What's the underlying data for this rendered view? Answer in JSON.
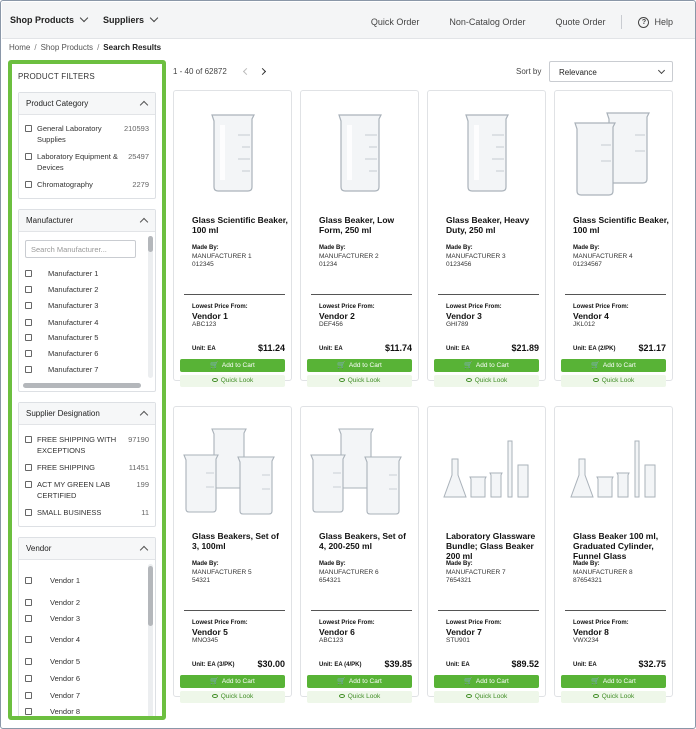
{
  "nav": {
    "shop_products": "Shop Products",
    "suppliers": "Suppliers",
    "quick_order": "Quick Order",
    "non_catalog_order": "Non-Catalog Order",
    "quote_order": "Quote Order",
    "help": "Help"
  },
  "breadcrumb": {
    "home": "Home",
    "shop": "Shop Products",
    "current": "Search Results"
  },
  "filters": {
    "title": "PRODUCT FILTERS",
    "category": {
      "title": "Product Category",
      "options": [
        {
          "label": "General Laboratory Supplies",
          "count": "210593"
        },
        {
          "label": "Laboratory Equipment & Devices",
          "count": "25497"
        },
        {
          "label": "Chromatography",
          "count": "2279"
        }
      ]
    },
    "manufacturer": {
      "title": "Manufacturer",
      "placeholder": "Search Manufacturer...",
      "options": [
        "Manufacturer 1",
        "Manufacturer 2",
        "Manufacturer 3",
        "Manufacturer 4",
        "Manufacturer 5",
        "Manufacturer 6",
        "Manufacturer 7"
      ]
    },
    "supplier": {
      "title": "Supplier Designation",
      "options": [
        {
          "label": "FREE SHIPPING WITH EXCEPTIONS",
          "count": "97190"
        },
        {
          "label": "FREE SHIPPING",
          "count": "11451"
        },
        {
          "label": "ACT MY GREEN LAB CERTIFIED",
          "count": "199"
        },
        {
          "label": "SMALL BUSINESS",
          "count": "11"
        }
      ]
    },
    "vendor": {
      "title": "Vendor",
      "options": [
        "Vendor 1",
        "Vendor 2",
        "Vendor 3",
        "Vendor 4",
        "Vendor 5",
        "Vendor 6",
        "Vendor 7",
        "Vendor 8"
      ]
    }
  },
  "results": {
    "count": "1 - 40 of 62872",
    "sort_label": "Sort by",
    "sort_value": "Relevance"
  },
  "labels": {
    "made_by": "Made By:",
    "lowest_price": "Lowest Price From:",
    "add_to_cart": "Add to Cart",
    "quick_look": "Quick Look"
  },
  "products": [
    {
      "name": "Glass Scientific Beaker, 100 ml",
      "mfr": "MANUFACTURER 1",
      "sku": "012345",
      "vendor": "Vendor 1",
      "vcode": "ABC123",
      "unit": "Unit: EA",
      "price": "$11.24",
      "image": "beaker-icon"
    },
    {
      "name": "Glass Beaker, Low Form, 250 ml",
      "mfr": "MANUFACTURER 2",
      "sku": "01234",
      "vendor": "Vendor 2",
      "vcode": "DEF456",
      "unit": "Unit: EA",
      "price": "$11.74",
      "image": "beaker-icon"
    },
    {
      "name": "Glass Beaker, Heavy Duty, 250 ml",
      "mfr": "MANUFACTURER 3",
      "sku": "0123456",
      "vendor": "Vendor 3",
      "vcode": "GHI789",
      "unit": "Unit: EA",
      "price": "$21.89",
      "image": "beaker-icon"
    },
    {
      "name": "Glass Scientific Beaker, 100 ml",
      "mfr": "MANUFACTURER 4",
      "sku": "01234567",
      "vendor": "Vendor 4",
      "vcode": "JKL012",
      "unit": "Unit: EA (2/PK)",
      "price": "$21.17",
      "image": "beaker-pair-icon"
    },
    {
      "name": "Glass Beakers, Set of 3, 100ml",
      "mfr": "MANUFACTURER 5",
      "sku": "54321",
      "vendor": "Vendor 5",
      "vcode": "MNO345",
      "unit": "Unit: EA (3/PK)",
      "price": "$30.00",
      "image": "beaker-set-icon"
    },
    {
      "name": "Glass Beakers, Set of 4, 200-250 ml",
      "mfr": "MANUFACTURER 6",
      "sku": "654321",
      "vendor": "Vendor 6",
      "vcode": "ABC123",
      "unit": "Unit: EA (4/PK)",
      "price": "$39.85",
      "image": "beaker-set-icon"
    },
    {
      "name": "Laboratory Glassware Bundle; Glass Beaker 200 ml",
      "mfr": "MANUFACTURER 7",
      "sku": "7654321",
      "vendor": "Vendor 7",
      "vcode": "STU901",
      "unit": "Unit: EA",
      "price": "$89.52",
      "image": "glassware-bundle-icon"
    },
    {
      "name": "Glass Beaker 100 ml, Graduated Cylinder, Funnel Glass",
      "mfr": "MANUFACTURER 8",
      "sku": "87654321",
      "vendor": "Vendor 8",
      "vcode": "VWX234",
      "unit": "Unit: EA",
      "price": "$32.75",
      "image": "glassware-bundle-icon"
    }
  ]
}
